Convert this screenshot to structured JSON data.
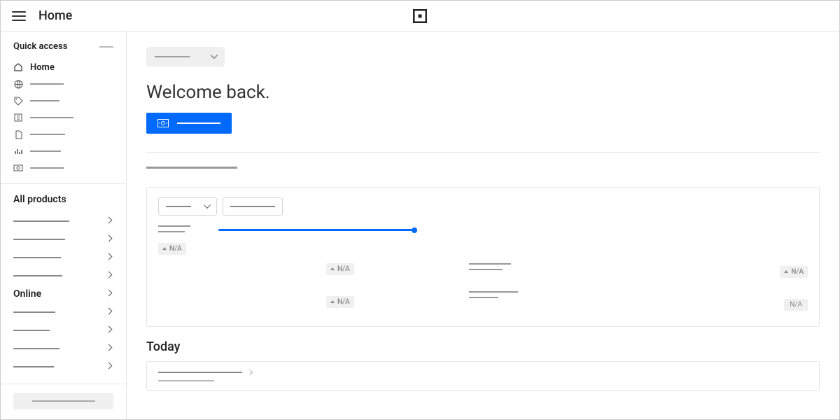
{
  "topbar": {
    "title": "Home"
  },
  "sidebar": {
    "quick_access": {
      "title": "Quick access",
      "home_label": "Home"
    },
    "all_products": {
      "title": "All products",
      "online_label": "Online"
    }
  },
  "main": {
    "welcome": "Welcome back.",
    "today_heading": "Today"
  },
  "badges": {
    "na": "N/A"
  },
  "colors": {
    "primary": "#006aff",
    "border": "#e5e5e5",
    "placeholder": "#999"
  }
}
